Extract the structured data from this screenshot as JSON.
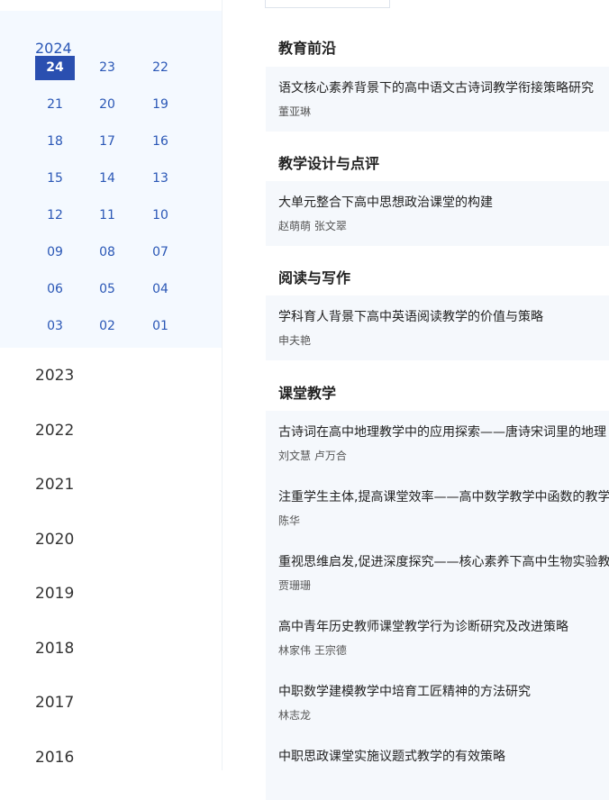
{
  "sidebar": {
    "current_year": "2024",
    "issues": [
      "24",
      "23",
      "22",
      "21",
      "20",
      "19",
      "18",
      "17",
      "16",
      "15",
      "14",
      "13",
      "12",
      "11",
      "10",
      "09",
      "08",
      "07",
      "06",
      "05",
      "04",
      "03",
      "02",
      "01"
    ],
    "active_issue": "24",
    "other_years": [
      "2023",
      "2022",
      "2021",
      "2020",
      "2019",
      "2018",
      "2017",
      "2016"
    ]
  },
  "sections": [
    {
      "title": "教育前沿",
      "articles": [
        {
          "title": "语文核心素养背景下的高中语文古诗词教学衔接策略研究",
          "authors": "董亚琳"
        }
      ]
    },
    {
      "title": "教学设计与点评",
      "articles": [
        {
          "title": "大单元整合下高中思想政治课堂的构建",
          "authors": "赵萌萌 张文翠"
        }
      ]
    },
    {
      "title": "阅读与写作",
      "articles": [
        {
          "title": "学科育人背景下高中英语阅读教学的价值与策略",
          "authors": "申夫艳"
        }
      ]
    },
    {
      "title": "课堂教学",
      "articles": [
        {
          "title": "古诗词在高中地理教学中的应用探索——唐诗宋词里的地理",
          "authors": "刘文慧 卢万合"
        },
        {
          "title": "注重学生主体,提高课堂效率——高中数学教学中函数的教学",
          "authors": "陈华"
        },
        {
          "title": "重视思维启发,促进深度探究——核心素养下高中生物实验教学",
          "authors": "贾珊珊"
        },
        {
          "title": "高中青年历史教师课堂教学行为诊断研究及改进策略",
          "authors": "林家伟 王宗德"
        },
        {
          "title": "中职数学建模教学中培育工匠精神的方法研究",
          "authors": "林志龙"
        },
        {
          "title": "中职思政课堂实施议题式教学的有效策略",
          "authors": ""
        }
      ]
    }
  ],
  "colors": {
    "accent": "#2a4fb0",
    "panel_bg": "#f4f9ff",
    "card_bg": "#f5f8fc"
  }
}
